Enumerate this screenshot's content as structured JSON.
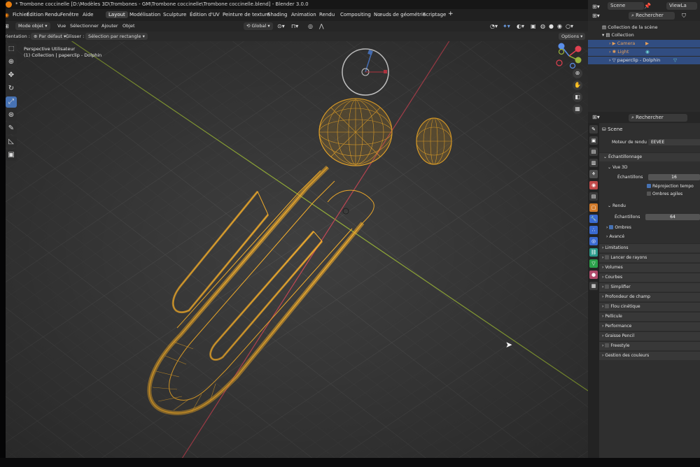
{
  "window_title": "* Trombone coccinelle [D:\\Modèles 3D\\Trombones - GM\\Trombone coccinelle\\Trombone coccinelle.blend] - Blender 3.0.0",
  "menu": [
    "Fichier",
    "Édition",
    "Rendu",
    "Fenêtre",
    "Aide"
  ],
  "workspaces": [
    "Layout",
    "Modélisation",
    "Sculpture",
    "Édition d'UV",
    "Peinture de texture",
    "Shading",
    "Animation",
    "Rendu",
    "Compositing",
    "Nœuds de géométrie",
    "Scriptage"
  ],
  "active_workspace": "Layout",
  "add_workspace": "+",
  "header": {
    "mode": "Mode objet",
    "view": "Vue",
    "select": "Sélectionner",
    "add": "Ajouter",
    "object": "Objet",
    "transform_orientation": "Global",
    "options": "Options"
  },
  "tool_settings": {
    "orientation_label": "Orientation :",
    "orientation_value": "Par défaut",
    "drag_label": "Glisser :",
    "drag_value": "Sélection par rectangle"
  },
  "viewport_info": {
    "line1": "Perspective Utilisateur",
    "line2": "(1) Collection | paperclip - Dolphin"
  },
  "toolbar_icons": [
    "select-box-icon",
    "cursor-icon",
    "move-icon",
    "rotate-icon",
    "scale-icon",
    "transform-icon",
    "annotate-icon",
    "measure-icon",
    "add-cube-icon"
  ],
  "top_right": {
    "scene_label": "Scene",
    "viewlayer_label": "ViewLa",
    "search_placeholder": "Rechercher"
  },
  "outliner": {
    "scene_collection": "Collection de la scène",
    "collection": "Collection",
    "items": [
      {
        "name": "Camera",
        "color": "#e8a15a"
      },
      {
        "name": "Light",
        "color": "#e8a15a"
      },
      {
        "name": "paperclip - Dolphin",
        "color": "#e0e0e0"
      }
    ]
  },
  "properties": {
    "search_placeholder": "Rechercher",
    "scene": "Scene",
    "render_engine_label": "Moteur de rendu",
    "render_engine_value": "EEVEE",
    "sampling": "Échantillonnage",
    "viewport_3d": "Vue 3D",
    "samples_label": "Échantillons",
    "viewport_samples": "16",
    "reprojection": "Réprojection tempo",
    "soft_shadows": "Ombres agiles",
    "render": "Rendu",
    "render_samples": "64",
    "shadows": "Ombres",
    "advanced": "Avancé",
    "sections": [
      "Limitations",
      "Lancer de rayons",
      "Volumes",
      "Courbes",
      "Simplifier",
      "Profondeur de champ",
      "Flou cinétique",
      "Pellicule",
      "Performance",
      "Graisse Pencil",
      "Freestyle",
      "Gestion des couleurs"
    ]
  },
  "colors": {
    "accent": "#4772b3",
    "selection": "#314d81",
    "wire": "#ffb62e",
    "axis_x": "#c94b59",
    "axis_y": "#9bb53c"
  }
}
